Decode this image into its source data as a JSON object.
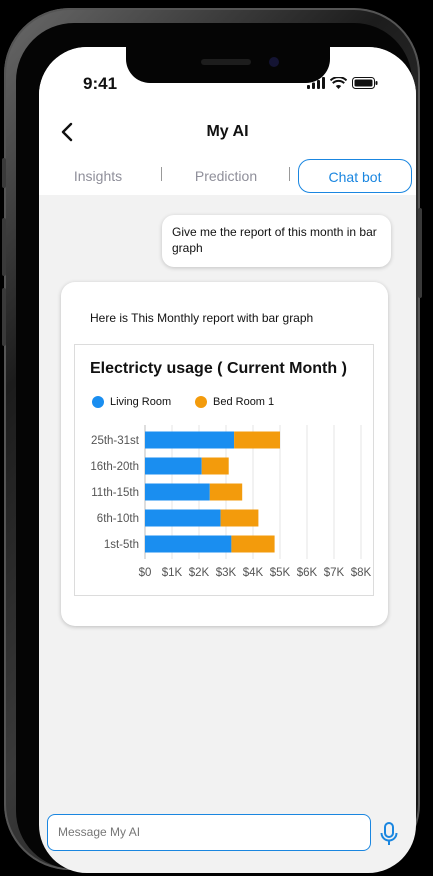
{
  "status_bar": {
    "time": "9:41"
  },
  "header": {
    "title": "My AI"
  },
  "tabs": [
    {
      "label": "Insights",
      "active": false
    },
    {
      "label": "Prediction",
      "active": false
    },
    {
      "label": "Chat bot",
      "active": true
    }
  ],
  "messages": {
    "user": "Give me the report of this month in bar graph",
    "assistant": "Here is This Monthly report with bar graph"
  },
  "chart_data": {
    "type": "bar",
    "orientation": "horizontal",
    "stacked": true,
    "title": "Electricty usage ( Current Month )",
    "categories": [
      "25th-31st",
      "16th-20th",
      "11th-15th",
      "6th-10th",
      "1st-5th"
    ],
    "series": [
      {
        "name": "Living Room",
        "color": "#1a8ef0",
        "values": [
          3.3,
          2.1,
          2.4,
          2.8,
          3.2
        ]
      },
      {
        "name": "Bed Room 1",
        "color": "#f39b0c",
        "values": [
          1.7,
          1.0,
          1.2,
          1.4,
          1.6
        ]
      }
    ],
    "x_ticks": [
      "$0",
      "$1K",
      "$2K",
      "$3K",
      "$4K",
      "$5K",
      "$6K",
      "$7K",
      "$8K"
    ],
    "xlim": [
      0,
      8
    ],
    "grid": true,
    "legend_position": "top-left"
  },
  "input": {
    "placeholder": "Message My AI"
  },
  "icons": {
    "back": "chevron-left-icon",
    "mic": "microphone-icon"
  },
  "colors": {
    "accent": "#1a86e0",
    "living_room": "#1a8ef0",
    "bed_room": "#f39b0c"
  }
}
